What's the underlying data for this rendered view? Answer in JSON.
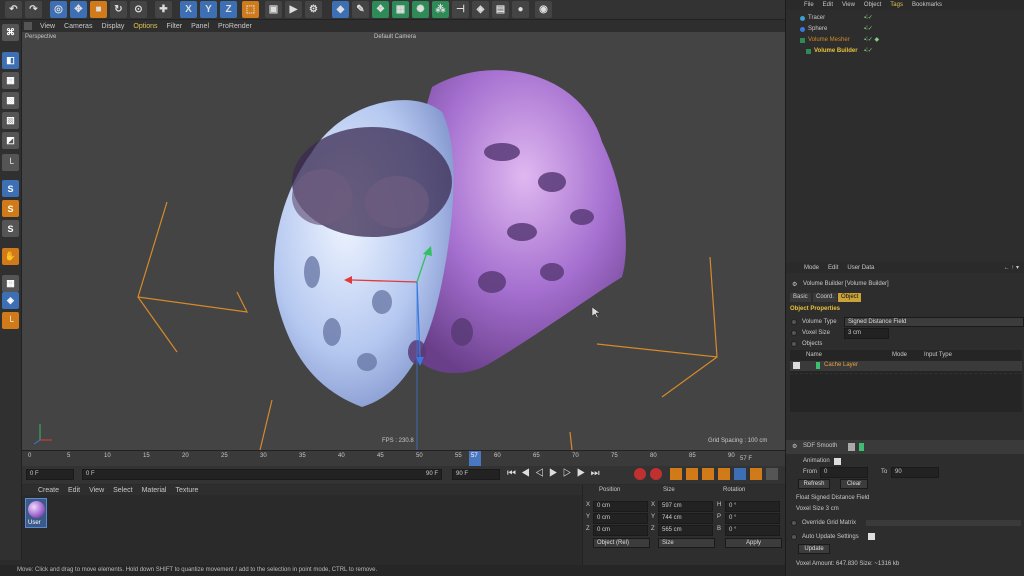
{
  "viewport": {
    "menu": [
      "View",
      "Cameras",
      "Display",
      "Options",
      "Filter",
      "Panel",
      "ProRender"
    ],
    "view_name": "Perspective",
    "camera": "Default Camera",
    "fps": "FPS : 230.8",
    "grid_spacing": "Grid Spacing : 100 cm"
  },
  "timeline": {
    "ticks": [
      "0",
      "5",
      "10",
      "15",
      "20",
      "25",
      "30",
      "35",
      "40",
      "45",
      "50",
      "55",
      "57",
      "60",
      "65",
      "70",
      "75",
      "80",
      "85",
      "90"
    ],
    "current_frame_label": "57 F",
    "start_field": "0 F",
    "offset_field": "0 F",
    "end_field": "90 F",
    "end_field2": "90 F"
  },
  "material_manager": {
    "menu": [
      "Create",
      "Edit",
      "View",
      "Select",
      "Material",
      "Texture"
    ],
    "material_name": "User"
  },
  "coordinates": {
    "headers": [
      "Position",
      "Size",
      "Rotation"
    ],
    "rows": [
      {
        "axis": "X",
        "pos": "0 cm",
        "saxis": "X",
        "size": "597 cm",
        "raxis": "H",
        "rot": "0 °"
      },
      {
        "axis": "Y",
        "pos": "0 cm",
        "saxis": "Y",
        "size": "744 cm",
        "raxis": "P",
        "rot": "0 °"
      },
      {
        "axis": "Z",
        "pos": "0 cm",
        "saxis": "Z",
        "size": "565 cm",
        "raxis": "B",
        "rot": "0 °"
      }
    ],
    "mode_select": "Object (Rel)",
    "size_select": "Size",
    "apply_label": "Apply"
  },
  "status": "Move: Click and drag to move elements. Hold down SHIFT to quantize movement / add to the selection in point mode, CTRL to remove.",
  "object_manager": {
    "menu": [
      "File",
      "Edit",
      "View",
      "Object",
      "Tags",
      "Bookmarks"
    ],
    "objects": [
      {
        "name": "Tracer",
        "color": "#c8c8c8"
      },
      {
        "name": "Sphere",
        "color": "#c8c8c8"
      },
      {
        "name": "Volume Mesher",
        "color": "#d08a2a"
      },
      {
        "name": "Volume Builder",
        "color": "#e8c23a"
      }
    ]
  },
  "attributes": {
    "menu": [
      "Mode",
      "Edit",
      "User Data"
    ],
    "title": "Volume Builder [Volume Builder]",
    "tabs": [
      "Basic",
      "Coord.",
      "Object"
    ],
    "section": "Object Properties",
    "volume_type_label": "Volume Type",
    "volume_type_value": "Signed Distance Field",
    "voxel_size_label": "Voxel Size",
    "voxel_size_value": "3 cm",
    "objects_label": "Objects",
    "list_headers": [
      "Name",
      "Mode",
      "Input Type"
    ],
    "list_first": "Cache Layer",
    "sdf_smooth": "SDF Smooth",
    "animation_label": "Animation",
    "from_label": "From",
    "from_value": "0",
    "to_label": "To",
    "to_value": "90",
    "refresh_label": "Refresh",
    "clear_label": "Clear",
    "float_label": "Float Signed Distance Field",
    "voxel_info": "Voxel Size 3 cm",
    "override_label": "Override Grid Matrix",
    "auto_update_label": "Auto Update Settings",
    "update_label": "Update",
    "voxel_amount": "Voxel Amount: 647.830   Size: ~1316 kb"
  },
  "colors": {
    "accent": "#c9a23a",
    "select_blue": "#3d6fb4",
    "orange": "#d07a1a"
  }
}
